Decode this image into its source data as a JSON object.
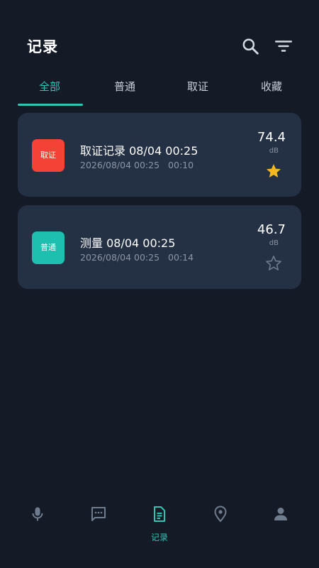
{
  "header": {
    "title": "记录",
    "search_icon": "search-icon",
    "filter_icon": "filter-icon"
  },
  "tabs": [
    {
      "label": "全部",
      "active": true
    },
    {
      "label": "普通",
      "active": false
    },
    {
      "label": "取证",
      "active": false
    },
    {
      "label": "收藏",
      "active": false
    }
  ],
  "records": [
    {
      "badge": "取证",
      "badge_color": "#f44336",
      "title": "取证记录 08/04 00:25",
      "date": "2026/08/04 00:25",
      "duration": "00:10",
      "value": "74.4",
      "unit": "dB",
      "favorite": true
    },
    {
      "badge": "普通",
      "badge_color": "#1fbfaf",
      "title": "测量 08/04 00:25",
      "date": "2026/08/04 00:25",
      "duration": "00:14",
      "value": "46.7",
      "unit": "dB",
      "favorite": false
    }
  ],
  "nav": {
    "items": [
      {
        "icon": "microphone-icon"
      },
      {
        "icon": "message-icon"
      },
      {
        "icon": "document-icon",
        "label": "记录",
        "active": true
      },
      {
        "icon": "location-icon"
      },
      {
        "icon": "person-icon"
      }
    ]
  },
  "colors": {
    "accent": "#2ec4b6",
    "background": "#141b26",
    "card": "#243044",
    "star": "#f5b820"
  }
}
